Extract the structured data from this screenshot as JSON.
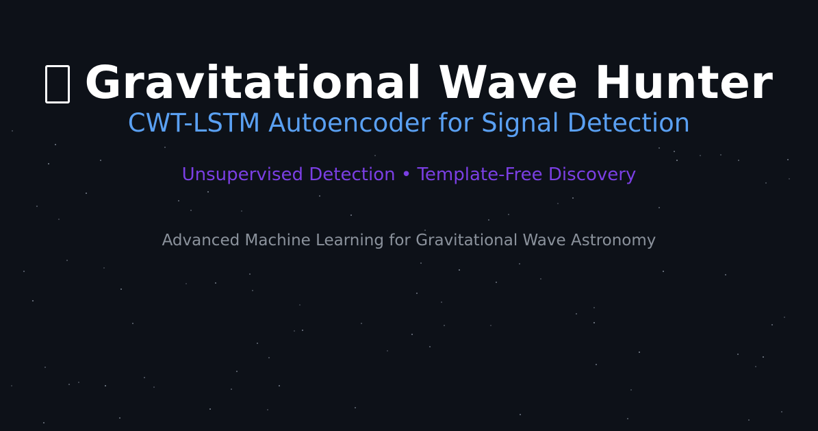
{
  "header": {
    "title": "Gravitational Wave Hunter",
    "title_icon": "missing-glyph-icon",
    "subtitle": "CWT-LSTM Autoencoder for Signal Detection",
    "tagline": "Unsupervised Detection • Template-Free Discovery",
    "description": "Advanced Machine Learning for Gravitational Wave Astronomy"
  },
  "colors": {
    "background": "#0d1118",
    "title": "#ffffff",
    "subtitle": "#5aa0f2",
    "tagline": "#7b3fe4",
    "description": "#8b929c",
    "stars": "#9aa3b2"
  }
}
